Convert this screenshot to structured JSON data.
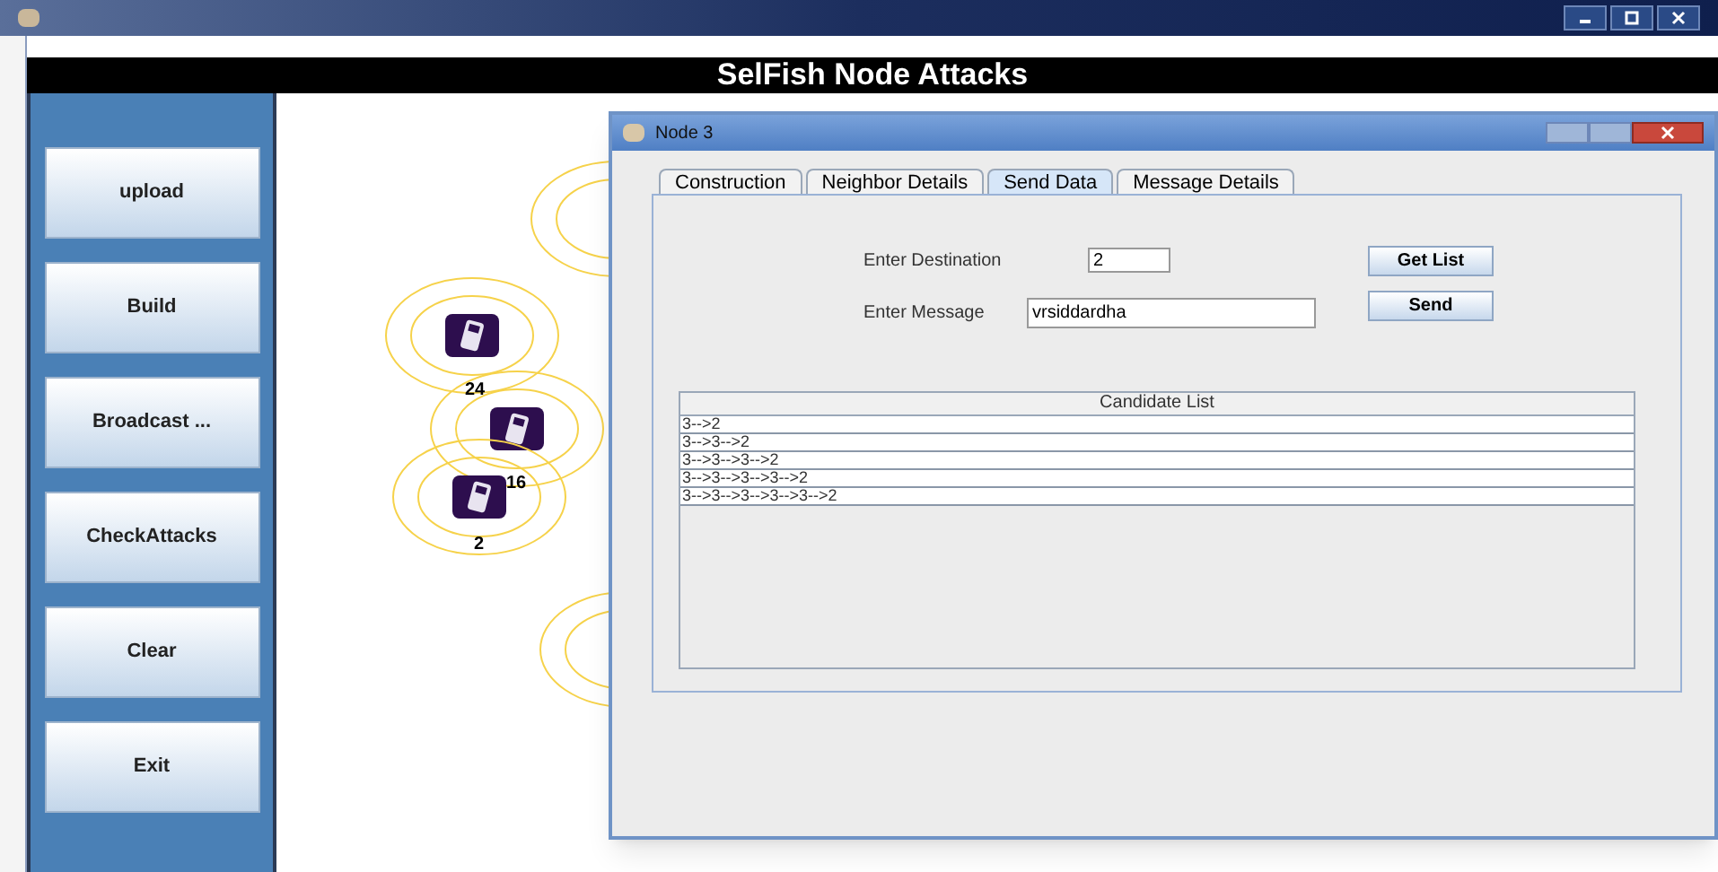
{
  "app_title": "SelFish Node Attacks",
  "sidebar_buttons": [
    "upload",
    "Build",
    "Broadcast ...",
    "CheckAttacks",
    "Clear",
    "Exit"
  ],
  "nodes": [
    {
      "label": "24"
    },
    {
      "label": "16"
    },
    {
      "label": "2"
    }
  ],
  "dialog": {
    "title": "Node 3",
    "tabs": [
      {
        "label": "Construction",
        "selected": false
      },
      {
        "label": "Neighbor Details",
        "selected": false
      },
      {
        "label": "Send Data",
        "selected": true
      },
      {
        "label": "Message Details",
        "selected": false
      }
    ],
    "destination": {
      "label": "Enter Destination",
      "value": "2"
    },
    "message": {
      "label": "Enter Message",
      "value": "vrsiddardha"
    },
    "buttons": [
      "Get List",
      "Send"
    ],
    "table": {
      "columns": [
        "Candidate List"
      ],
      "rows": [
        "3-->2",
        "3-->3-->2",
        "3-->3-->3-->2",
        "3-->3-->3-->3-->2",
        "3-->3-->3-->3-->3-->2"
      ]
    }
  }
}
